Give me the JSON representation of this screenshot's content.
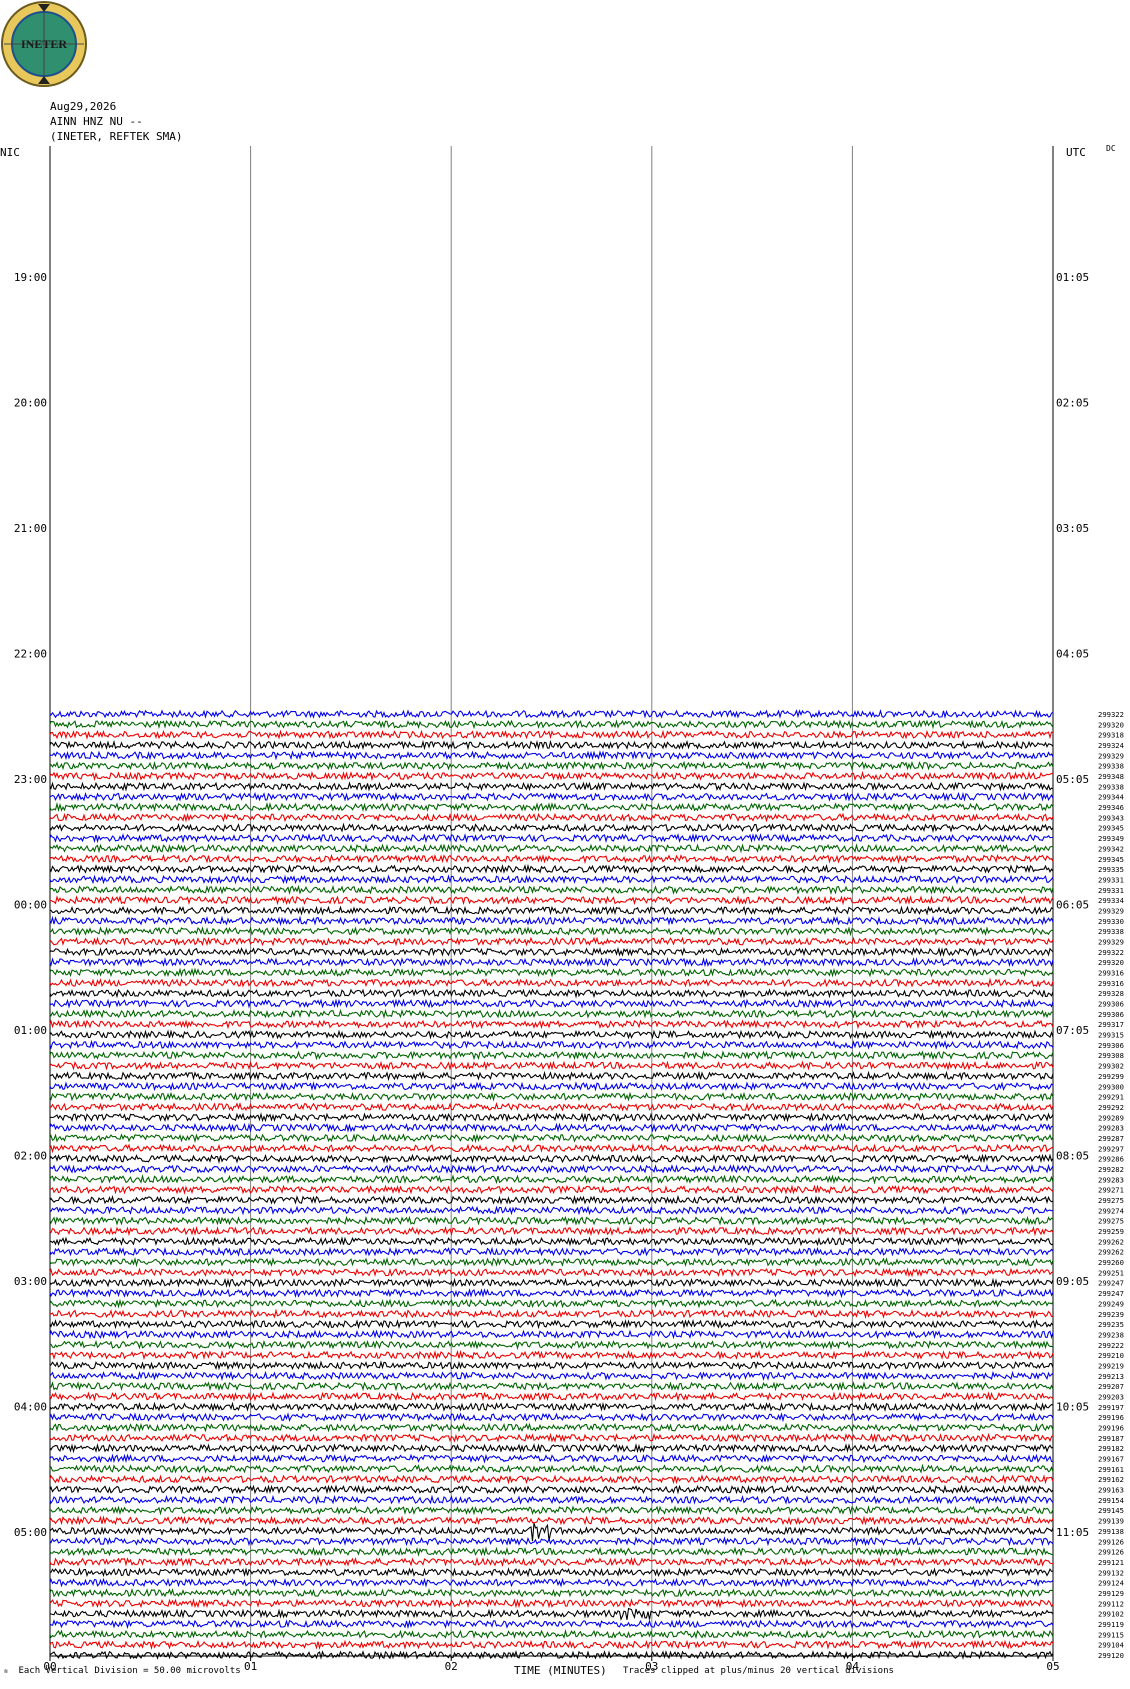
{
  "header": {
    "date": "Aug29,2026",
    "station": "AINN HNZ NU --",
    "network": "(INETER, REFTEK SMA)",
    "left_timezone": "NIC",
    "right_timezone": "UTC",
    "dc_label": "DC"
  },
  "logo": {
    "text": "INETER"
  },
  "footer": {
    "scale_note": "Each Vertical Division =    50.00 microvolts",
    "xlabel": "TIME (MINUTES)",
    "clip_note": "Traces clipped at plus/minus 20 vertical divisions"
  },
  "colors": {
    "trace_cycle": [
      "#0000ff",
      "#00aa00",
      "#ff0000",
      "#000000"
    ],
    "trace_cycle_actual": [
      "#0000ee",
      "#006400",
      "#ee0000",
      "#000000"
    ],
    "gridline": "#808080"
  },
  "chart_data": {
    "type": "line",
    "title": "",
    "xlabel": "TIME (MINUTES)",
    "xlim": [
      0,
      5
    ],
    "x_ticks": [
      "00",
      "01",
      "02",
      "03",
      "04",
      "05"
    ],
    "left_hour_labels": [
      "19:00",
      "20:00",
      "21:00",
      "22:00",
      "23:00",
      "00:00",
      "01:00",
      "02:00",
      "03:00",
      "04:00",
      "05:00"
    ],
    "right_hour_labels": [
      "01:05",
      "02:05",
      "03:05",
      "04:05",
      "05:05",
      "06:05",
      "07:05",
      "08:05",
      "09:05",
      "10:05",
      "11:05"
    ],
    "lines_per_hour": 12,
    "first_trace_hour_offset": 4.5,
    "trace_values": [
      "299322",
      "299320",
      "299318",
      "299324",
      "299329",
      "299338",
      "299348",
      "299338",
      "299344",
      "299346",
      "299343",
      "299345",
      "299349",
      "299342",
      "299345",
      "299335",
      "299331",
      "299331",
      "299334",
      "299329",
      "299330",
      "299338",
      "299329",
      "299322",
      "299320",
      "299316",
      "299316",
      "299328",
      "299306",
      "299306",
      "299317",
      "299315",
      "299306",
      "299308",
      "299302",
      "299299",
      "299300",
      "299291",
      "299292",
      "299289",
      "299283",
      "299287",
      "299297",
      "299286",
      "299282",
      "299283",
      "299271",
      "299275",
      "299274",
      "299275",
      "299259",
      "299262",
      "299262",
      "299260",
      "299251",
      "299247",
      "299247",
      "299249",
      "299239",
      "299235",
      "299238",
      "299222",
      "299210",
      "299219",
      "299213",
      "299207",
      "299203",
      "299197",
      "299196",
      "299196",
      "299187",
      "299182",
      "299167",
      "299161",
      "299162",
      "299163",
      "299154",
      "299145",
      "299139",
      "299138",
      "299126",
      "299126",
      "299121",
      "299132",
      "299124",
      "299129",
      "299112",
      "299102",
      "299119",
      "299115",
      "299104",
      "299120"
    ]
  }
}
